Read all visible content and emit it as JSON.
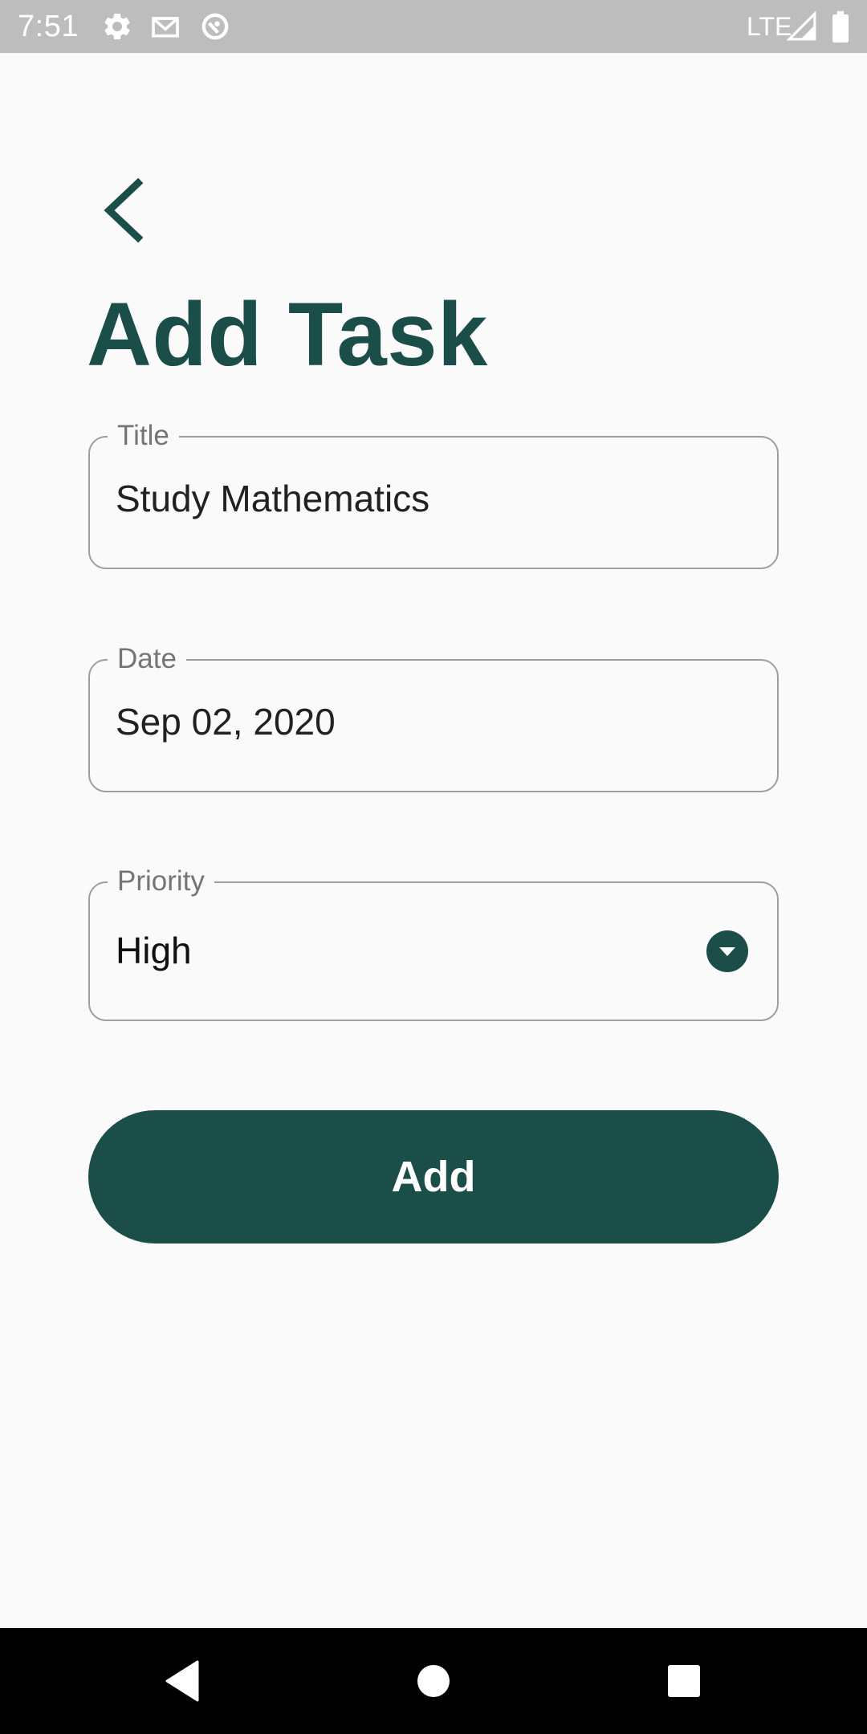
{
  "status_bar": {
    "time": "7:51",
    "network": "LTE",
    "icons": [
      "settings-icon",
      "gmail-icon",
      "sync-icon",
      "signal-icon",
      "battery-icon"
    ]
  },
  "header": {
    "back_icon": "chevron-left-icon",
    "title": "Add Task"
  },
  "form": {
    "title_field": {
      "label": "Title",
      "value": "Study Mathematics"
    },
    "date_field": {
      "label": "Date",
      "value": "Sep 02, 2020"
    },
    "priority_field": {
      "label": "Priority",
      "value": "High",
      "icon": "arrow-drop-down-circle-icon"
    }
  },
  "actions": {
    "add_label": "Add"
  },
  "nav_bar": {
    "icons": [
      "back-triangle-icon",
      "home-circle-icon",
      "recents-square-icon"
    ]
  },
  "colors": {
    "accent": "#1B4D49",
    "background": "#FAFAFA",
    "status_bar": "#BDBDBD",
    "field_border": "#9E9E9E",
    "label": "#757575"
  }
}
